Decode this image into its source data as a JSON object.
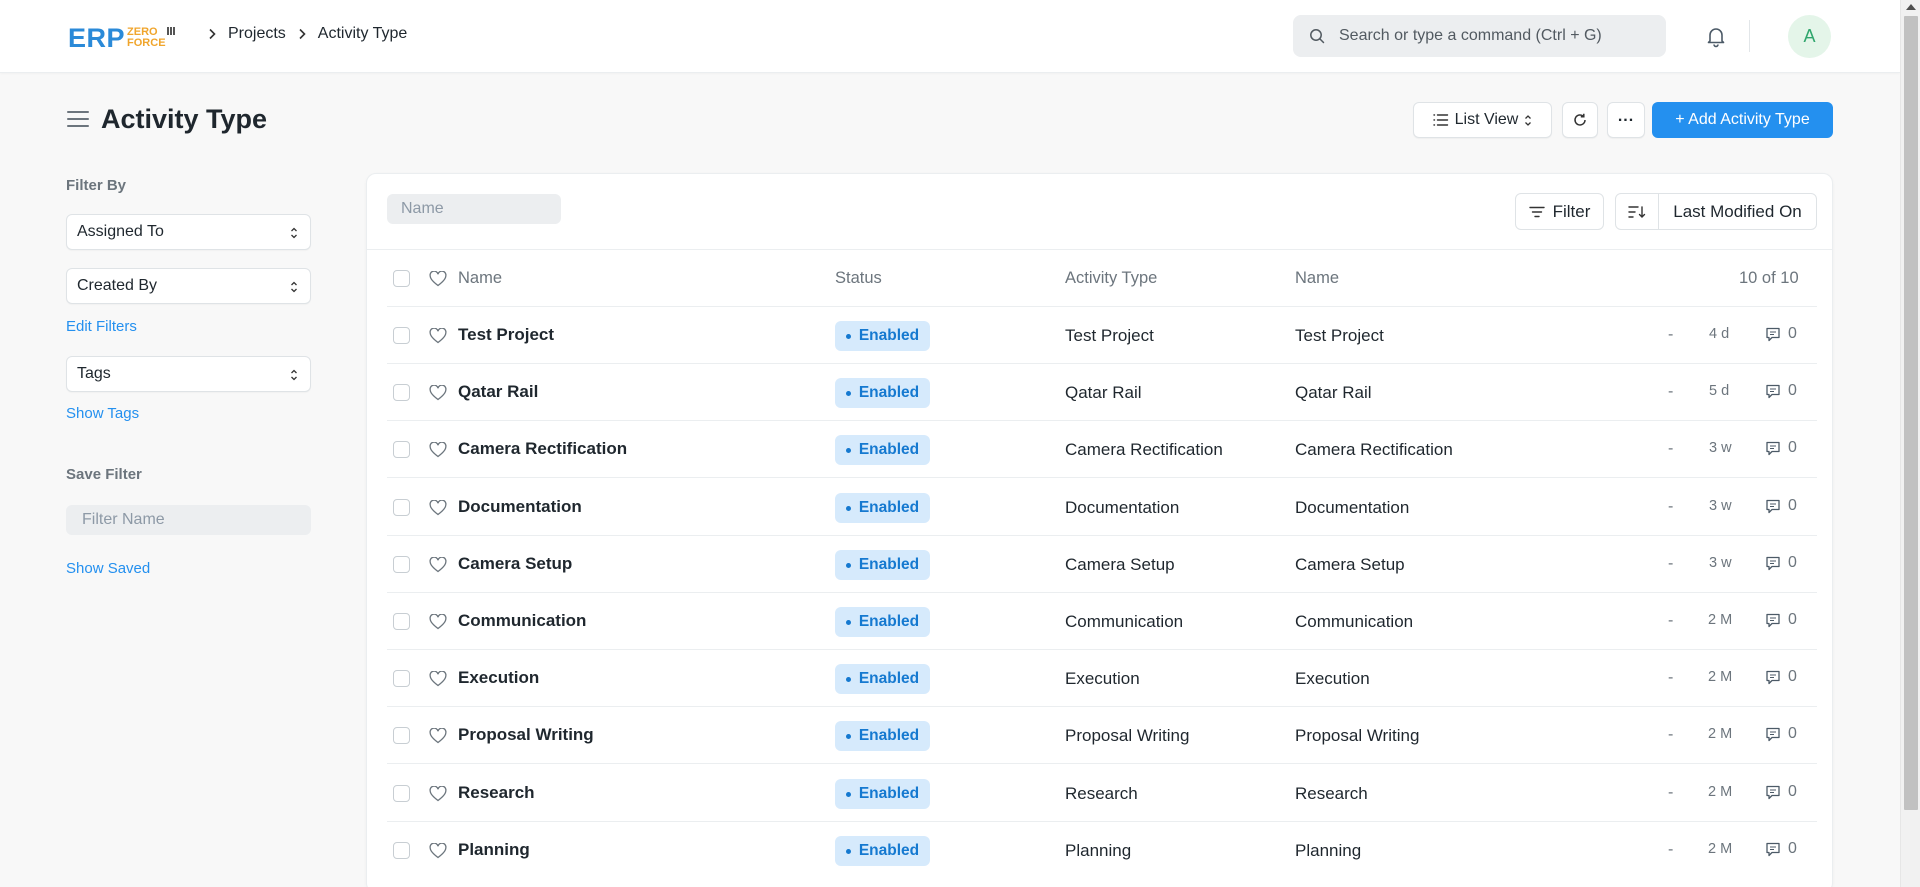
{
  "navbar": {
    "logo_main": "ERP",
    "logo_sub1": "ZERO",
    "logo_sub2": "FORCE",
    "breadcrumbs": [
      "Projects",
      "Activity Type"
    ],
    "search_placeholder": "Search or type a command (Ctrl + G)",
    "avatar_initial": "A"
  },
  "page": {
    "title": "Activity Type",
    "list_view_label": "List View",
    "more_label": "...",
    "add_button_label": "+ Add Activity Type"
  },
  "sidebar": {
    "filter_by_label": "Filter By",
    "assigned_to": "Assigned To",
    "created_by": "Created By",
    "edit_filters": "Edit Filters",
    "tags": "Tags",
    "show_tags": "Show Tags",
    "save_filter_label": "Save Filter",
    "filter_name_placeholder": "Filter Name",
    "show_saved": "Show Saved"
  },
  "list": {
    "name_filter_placeholder": "Name",
    "filter_label": "Filter",
    "sort_label": "Last Modified On",
    "columns": [
      "Name",
      "Status",
      "Activity Type",
      "Name"
    ],
    "count": "10 of 10",
    "rows": [
      {
        "name": "Test Project",
        "status": "Enabled",
        "activity_type": "Test Project",
        "name2": "Test Project",
        "dash": "-",
        "age": "4 d",
        "comments": "0"
      },
      {
        "name": "Qatar Rail",
        "status": "Enabled",
        "activity_type": "Qatar Rail",
        "name2": "Qatar Rail",
        "dash": "-",
        "age": "5 d",
        "comments": "0"
      },
      {
        "name": "Camera Rectification",
        "status": "Enabled",
        "activity_type": "Camera Rectification",
        "name2": "Camera Rectification",
        "dash": "-",
        "age": "3 w",
        "comments": "0"
      },
      {
        "name": "Documentation",
        "status": "Enabled",
        "activity_type": "Documentation",
        "name2": "Documentation",
        "dash": "-",
        "age": "3 w",
        "comments": "0"
      },
      {
        "name": "Camera Setup",
        "status": "Enabled",
        "activity_type": "Camera Setup",
        "name2": "Camera Setup",
        "dash": "-",
        "age": "3 w",
        "comments": "0"
      },
      {
        "name": "Communication",
        "status": "Enabled",
        "activity_type": "Communication",
        "name2": "Communication",
        "dash": "-",
        "age": "2 M",
        "comments": "0"
      },
      {
        "name": "Execution",
        "status": "Enabled",
        "activity_type": "Execution",
        "name2": "Execution",
        "dash": "-",
        "age": "2 M",
        "comments": "0"
      },
      {
        "name": "Proposal Writing",
        "status": "Enabled",
        "activity_type": "Proposal Writing",
        "name2": "Proposal Writing",
        "dash": "-",
        "age": "2 M",
        "comments": "0"
      },
      {
        "name": "Research",
        "status": "Enabled",
        "activity_type": "Research",
        "name2": "Research",
        "dash": "-",
        "age": "2 M",
        "comments": "0"
      },
      {
        "name": "Planning",
        "status": "Enabled",
        "activity_type": "Planning",
        "name2": "Planning",
        "dash": "-",
        "age": "2 M",
        "comments": "0"
      }
    ]
  },
  "colors": {
    "primary": "#2490ef",
    "badge_bg": "#d6eafc",
    "badge_text": "#1579d0",
    "logo_blue": "#2b8ad8",
    "logo_orange": "#f0a52c"
  }
}
